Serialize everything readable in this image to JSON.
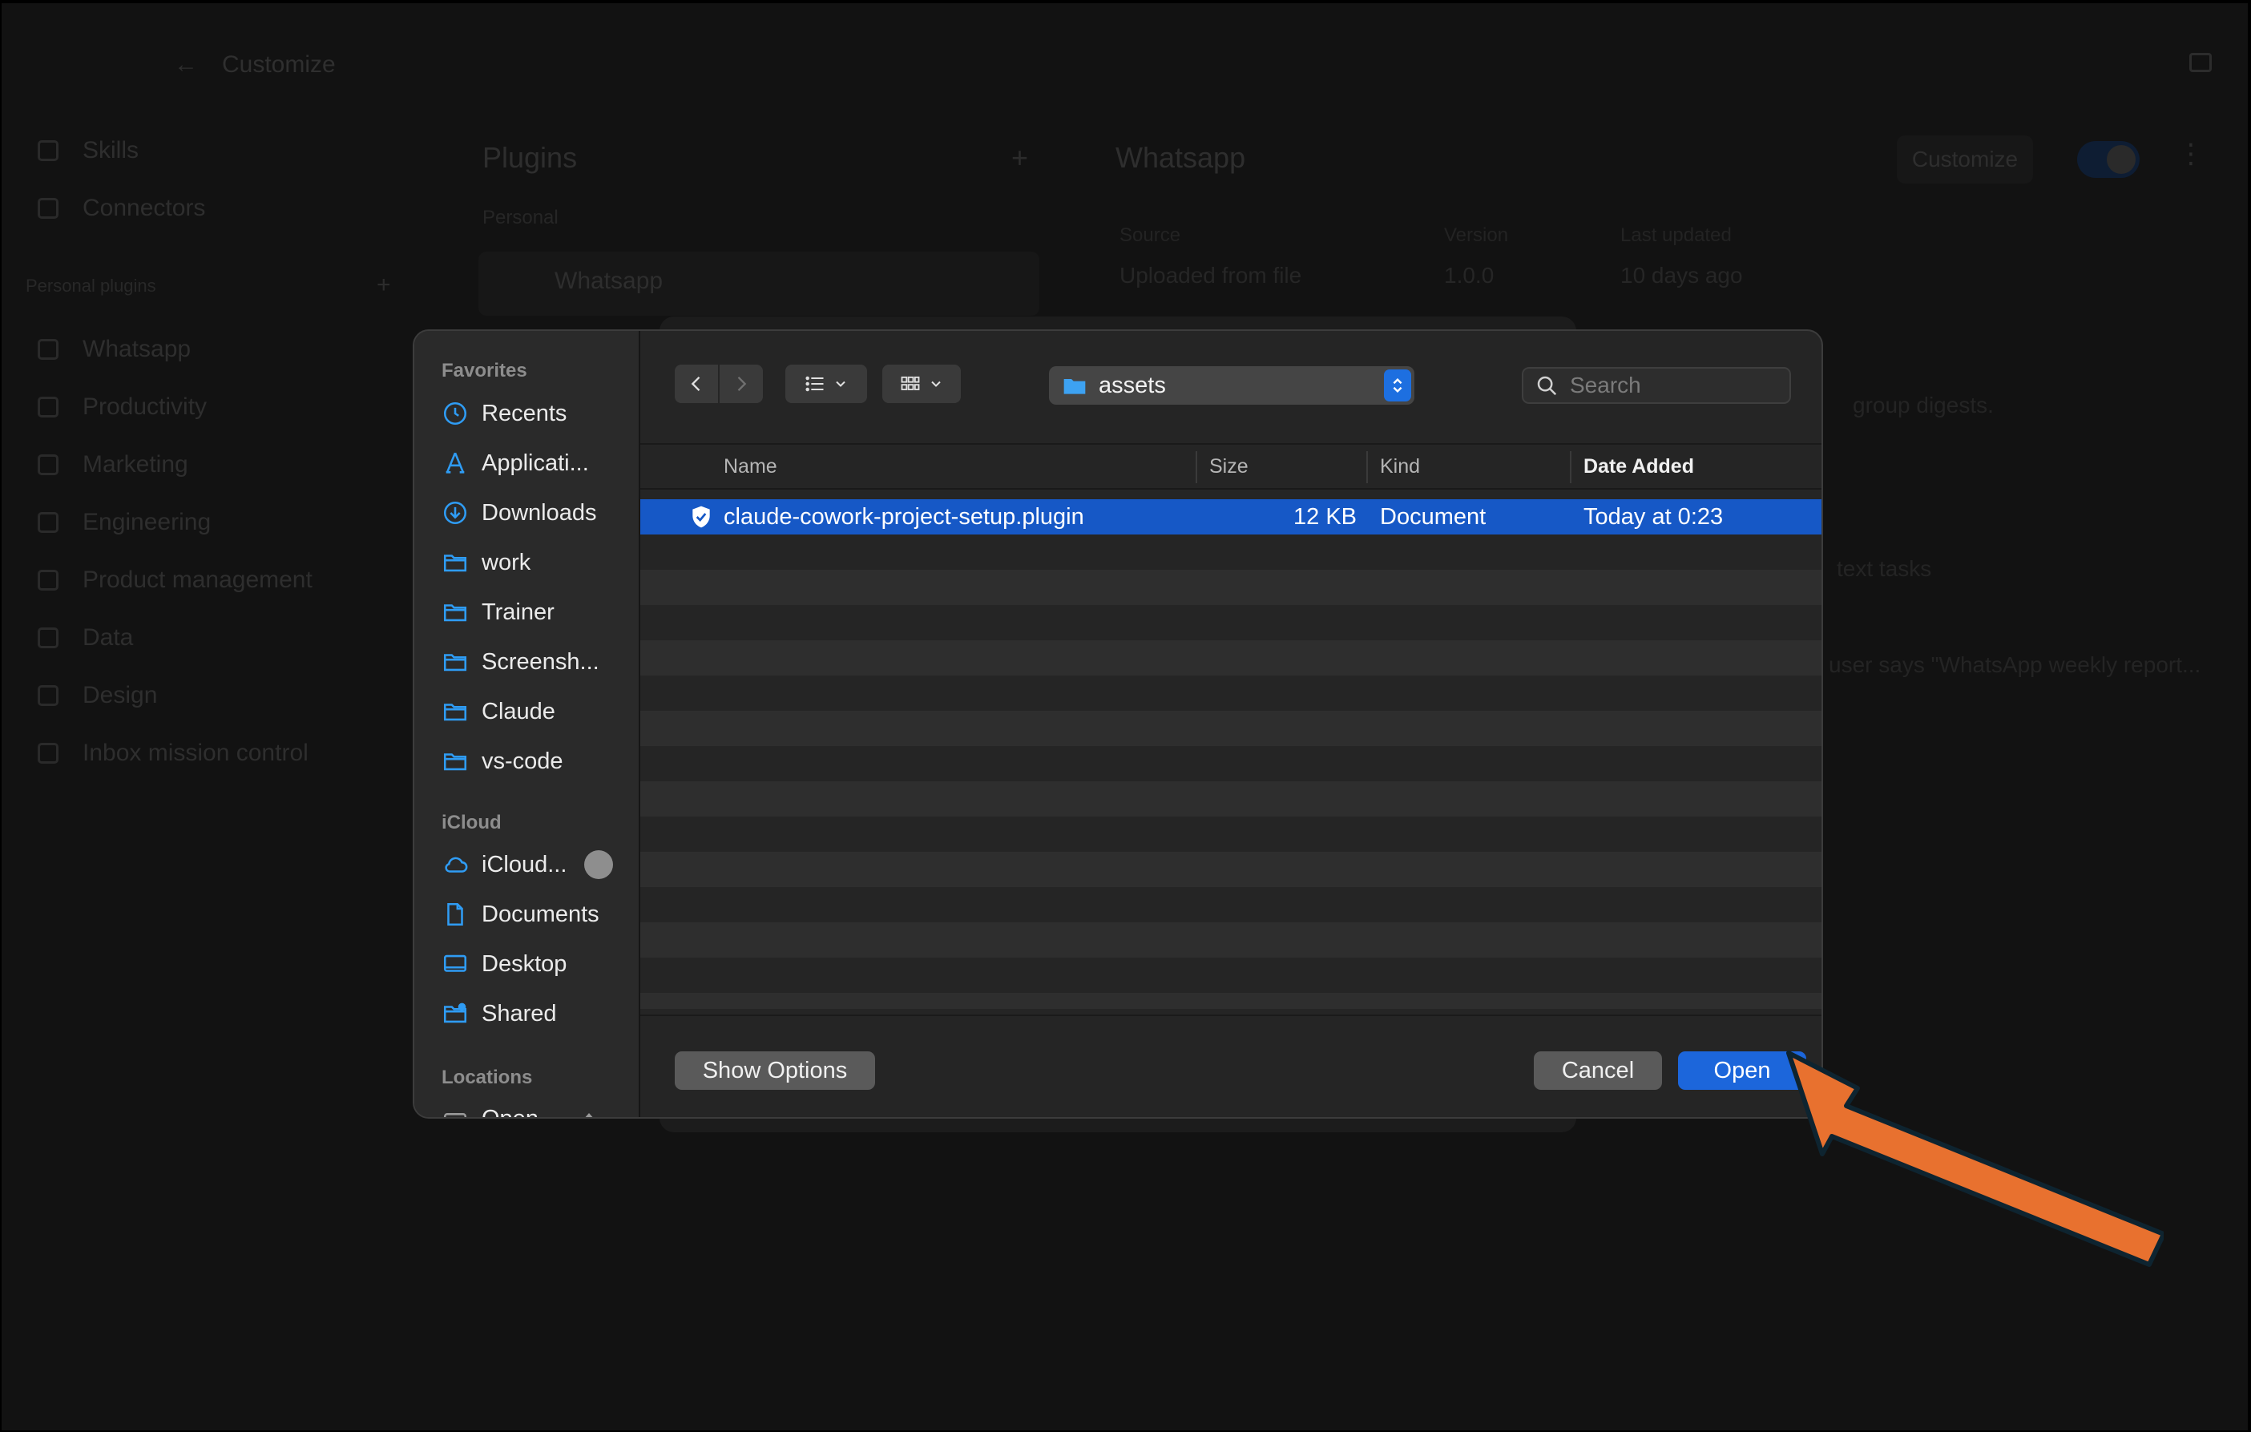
{
  "background_app": {
    "title": "Customize",
    "sidebar": {
      "items": [
        "Skills",
        "Connectors"
      ],
      "section_label": "Personal plugins",
      "plugins": [
        "Whatsapp",
        "Productivity",
        "Marketing",
        "Engineering",
        "Product management",
        "Data",
        "Design",
        "Inbox mission control"
      ]
    },
    "plugins_panel": {
      "title": "Plugins",
      "group": "Personal",
      "item": "Whatsapp"
    },
    "detail": {
      "title": "Whatsapp",
      "customize_label": "Customize",
      "meta_headers": [
        "Source",
        "Version",
        "Last updated"
      ],
      "meta_values": [
        "Uploaded from file",
        "1.0.0",
        "10 days ago"
      ],
      "lines": [
        "group digests.",
        "text tasks",
        "user says \"WhatsApp weekly report..."
      ]
    }
  },
  "dialog": {
    "sidebar": {
      "favorites_heading": "Favorites",
      "favorites": [
        {
          "label": "Recents",
          "icon": "clock-icon"
        },
        {
          "label": "Applicati...",
          "icon": "applications-icon"
        },
        {
          "label": "Downloads",
          "icon": "download-icon"
        },
        {
          "label": "work",
          "icon": "folder-icon"
        },
        {
          "label": "Trainer",
          "icon": "folder-icon"
        },
        {
          "label": "Screensh...",
          "icon": "folder-icon"
        },
        {
          "label": "Claude",
          "icon": "folder-icon"
        },
        {
          "label": "vs-code",
          "icon": "folder-icon"
        }
      ],
      "icloud_heading": "iCloud",
      "icloud": [
        {
          "label": "iCloud...",
          "icon": "cloud-icon"
        },
        {
          "label": "Documents",
          "icon": "document-icon"
        },
        {
          "label": "Desktop",
          "icon": "desktop-icon"
        },
        {
          "label": "Shared",
          "icon": "shared-folder-icon"
        }
      ],
      "locations_heading": "Locations",
      "locations": [
        {
          "label": "Open",
          "icon": "disk-icon"
        }
      ]
    },
    "toolbar": {
      "current_folder": "assets",
      "search_placeholder": "Search"
    },
    "columns": [
      "Name",
      "Size",
      "Kind",
      "Date Added"
    ],
    "sorted_column": "Date Added",
    "files": [
      {
        "name": "claude-cowork-project-setup.plugin",
        "size": "12 KB",
        "kind": "Document",
        "date_added": "Today at 0:23",
        "selected": true
      }
    ],
    "buttons": {
      "show_options": "Show Options",
      "cancel": "Cancel",
      "open": "Open"
    }
  },
  "colors": {
    "accent": "#1c66db",
    "selection": "#1658c6",
    "annotation_arrow": "#e8712f",
    "sidebar_icon": "#2f9cf4"
  }
}
